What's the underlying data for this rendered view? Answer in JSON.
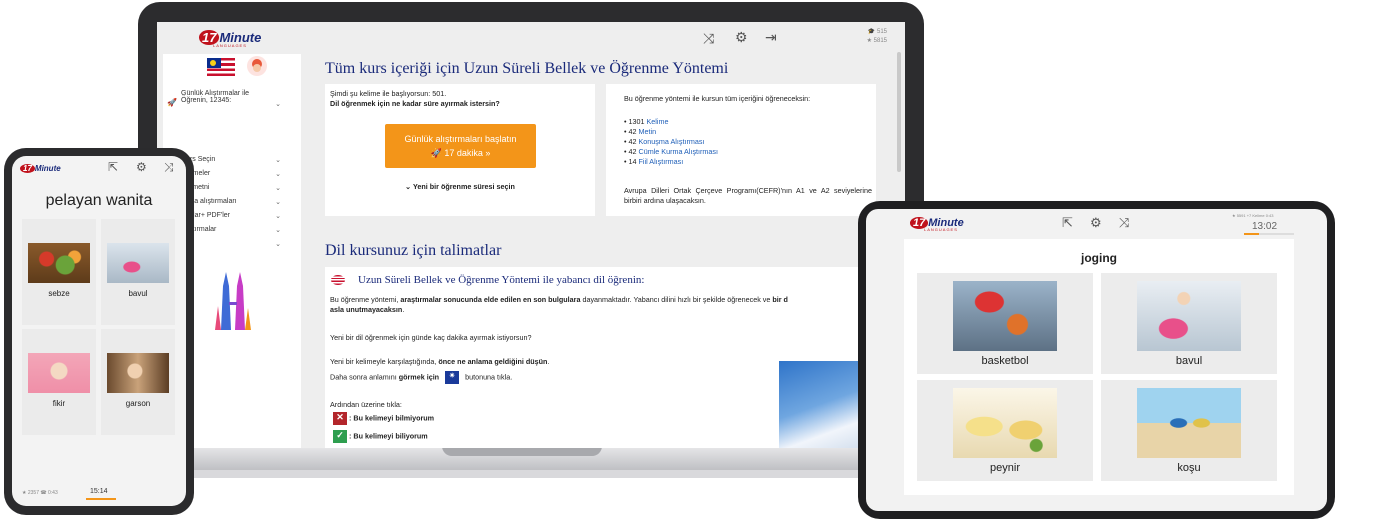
{
  "laptop": {
    "logo": {
      "num": "17",
      "word": "Minute",
      "sub": "LANGUAGES"
    },
    "stats": {
      "courses": "515",
      "stars": "5815"
    },
    "sidebar": {
      "items": [
        {
          "label": "Günlük Alıştırmalar ile Öğrenin, 12345:"
        },
        {
          "label": "Ders Seçin"
        },
        {
          "label": "Kelimeler"
        },
        {
          "label": "log metni"
        },
        {
          "label": "uşma alıştırmaları"
        },
        {
          "label": "rmalar+ PDF'ler"
        },
        {
          "label": "Alıştırmalar"
        },
        {
          "label": "alar"
        }
      ]
    },
    "main": {
      "title": "Tüm kurs içeriği için Uzun Süreli Bellek ve Öğrenme Yöntemi",
      "left_card": {
        "line1": "Şimdi şu kelime ile başlıyorsun: 501.",
        "line2": "Dil öğrenmek için ne kadar süre ayırmak istersin?",
        "button_line1": "Günlük alıştırmaları başlatın",
        "button_line2": "17 dakika »",
        "choose_time": "Yeni bir öğrenme süresi seçin"
      },
      "right_card": {
        "intro": "Bu öğrenme yöntemi ile kursun tüm içeriğini öğreneceksin:",
        "items": [
          {
            "count": "• 1301 ",
            "link": "Kelime"
          },
          {
            "count": "• 42 ",
            "link": "Metin"
          },
          {
            "count": "• 42 ",
            "link": "Konuşma Alıştırması"
          },
          {
            "count": "• 42 ",
            "link": "Cümle Kurma Alıştırması"
          },
          {
            "count": "• 14 ",
            "link": "Fiil Alıştırması"
          }
        ],
        "cefr": "Avrupa Dilleri Ortak Çerçeve Programı(CEFR)'nın A1 ve A2 seviyelerine birbiri ardına ulaşacaksın."
      },
      "instructions_title": "Dil kursunuz için talimatlar",
      "instructions": {
        "heading": "Uzun Süreli Bellek ve Öğrenme Yöntemi ile yabancı dil öğrenin:",
        "p1_a": "Bu öğrenme yöntemi, ",
        "p1_b": "araştırmalar sonucunda elde edilen en son bulgulara",
        "p1_c": " dayanmaktadır. Yabancı dilini hızlı bir şekilde öğrenecek ve ",
        "p1_d": "bir d",
        "p1_e": "asla unutmayacaksın",
        "p1_f": ".",
        "p2": "Yeni bir dil öğrenmek için günde kaç dakika ayırmak istiyorsun?",
        "p3_a": "Yeni bir kelimeyle karşılaştığında, ",
        "p3_b": "önce ne anlama geldiğini düşün",
        "p3_c": ".",
        "p4_a": "Daha sonra anlamını ",
        "p4_b": "görmek için",
        "p4_c": "butonuna tıkla.",
        "p5": "Ardından üzerine tıkla:",
        "no_label": ": Bu kelimeyi bilmiyorum",
        "yes_label": ": Bu kelimeyi biliyorum"
      }
    }
  },
  "phone": {
    "word": "pelayan wanita",
    "tiles": [
      {
        "label": "sebze"
      },
      {
        "label": "bavul"
      },
      {
        "label": "fikir"
      },
      {
        "label": "garson"
      }
    ],
    "footer": {
      "stats": "2357 ☎ 0:43",
      "time": "15:14"
    }
  },
  "tablet": {
    "word": "joging",
    "stats": "5591 +7 Kelime 0:43",
    "time": "13:02",
    "tiles": [
      {
        "label": "basketbol"
      },
      {
        "label": "bavul"
      },
      {
        "label": "peynir"
      },
      {
        "label": "koşu"
      }
    ]
  },
  "colors": {
    "brand_blue": "#1a2a7a",
    "brand_red": "#c0121c",
    "accent_orange": "#f39519",
    "link_blue": "#1f5fb8"
  }
}
